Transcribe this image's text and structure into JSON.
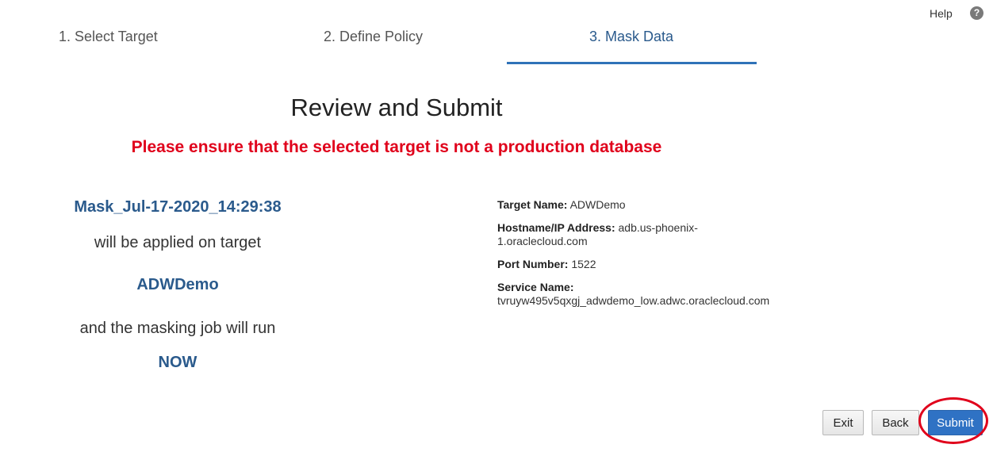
{
  "header": {
    "help_label": "Help",
    "help_icon_glyph": "?"
  },
  "wizard": {
    "steps": [
      {
        "label": "1. Select Target",
        "active": false
      },
      {
        "label": "2. Define Policy",
        "active": false
      },
      {
        "label": "3. Mask Data",
        "active": true
      }
    ],
    "active_color": "#2f72b8"
  },
  "page": {
    "title": "Review and Submit",
    "warning": "Please ensure that the selected target is not a production database",
    "warning_color": "#e0001b"
  },
  "summary": {
    "mask_name": "Mask_Jul-17-2020_14:29:38",
    "applied_text": "will be applied on target",
    "target": "ADWDemo",
    "job_text": "and the masking job will run",
    "run_when": "NOW"
  },
  "details": {
    "target_name_label": "Target Name:",
    "target_name_value": "ADWDemo",
    "hostname_label": "Hostname/IP Address:",
    "hostname_value": "adb.us-phoenix-1.oraclecloud.com",
    "port_label": "Port Number:",
    "port_value": "1522",
    "service_label": "Service Name:",
    "service_value": "tvruyw495v5qxgj_adwdemo_low.adwc.oraclecloud.com"
  },
  "buttons": {
    "exit": "Exit",
    "back": "Back",
    "submit": "Submit"
  }
}
